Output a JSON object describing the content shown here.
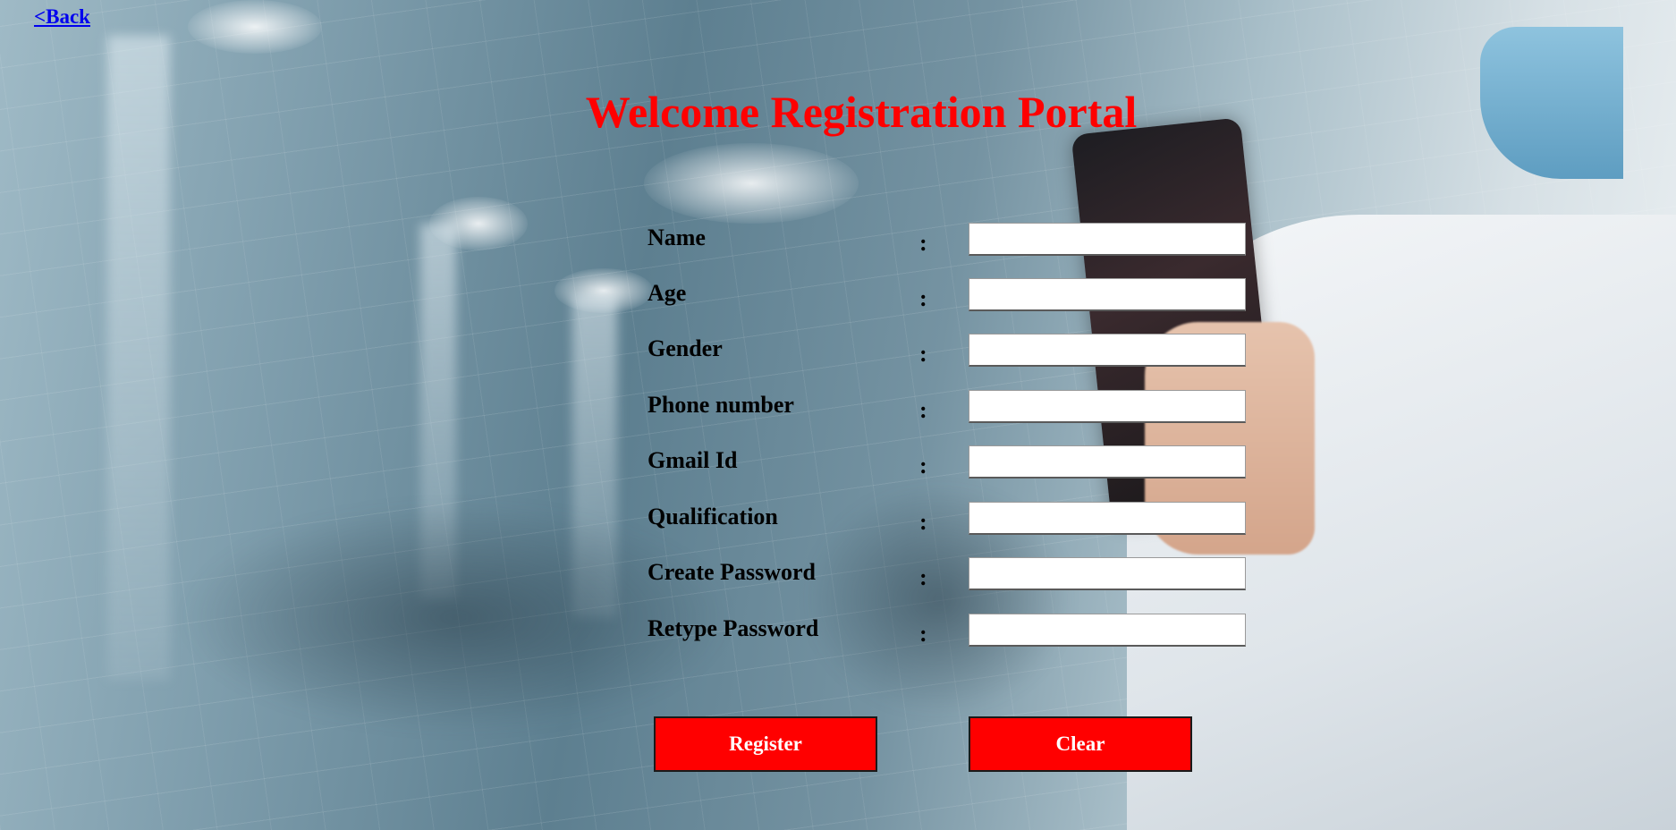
{
  "back_link": "<Back",
  "title": "Welcome Registration Portal",
  "form": {
    "fields": [
      {
        "label": "Name",
        "colon": ":",
        "value": ""
      },
      {
        "label": "Age",
        "colon": ":",
        "value": ""
      },
      {
        "label": "Gender",
        "colon": ":",
        "value": ""
      },
      {
        "label": "Phone number",
        "colon": ":",
        "value": ""
      },
      {
        "label": "Gmail Id",
        "colon": ":",
        "value": ""
      },
      {
        "label": "Qualification",
        "colon": ":",
        "value": ""
      },
      {
        "label": "Create Password",
        "colon": ":",
        "value": ""
      },
      {
        "label": "Retype Password",
        "colon": ":",
        "value": ""
      }
    ]
  },
  "buttons": {
    "register": "Register",
    "clear": "Clear"
  },
  "colors": {
    "title": "#ff0000",
    "button_bg": "#ff0000",
    "button_text": "#ffffff",
    "link": "#0000ee"
  }
}
